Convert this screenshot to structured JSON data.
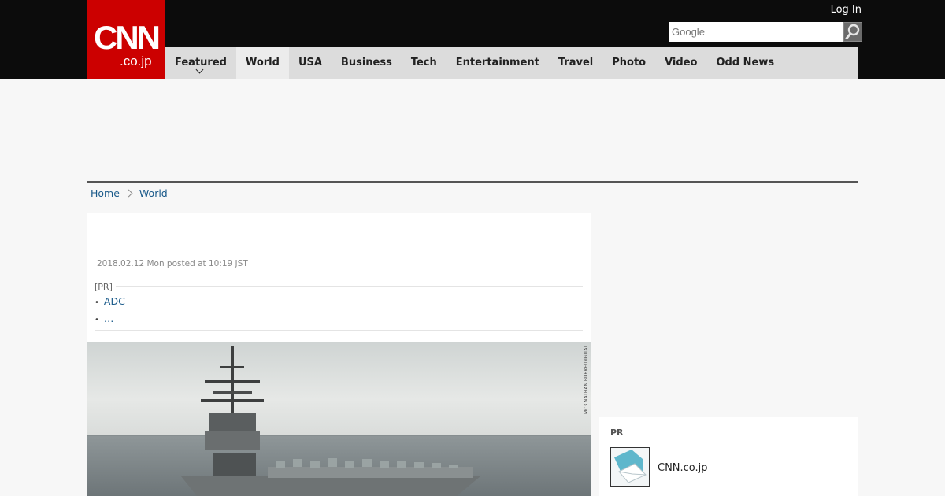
{
  "header": {
    "logo_main": "CNN",
    "logo_sub": ".co.jp",
    "login_label": "Log In",
    "search_placeholder": "Google"
  },
  "nav": {
    "items": [
      {
        "label": "Featured"
      },
      {
        "label": "World"
      },
      {
        "label": "USA"
      },
      {
        "label": "Business"
      },
      {
        "label": "Tech"
      },
      {
        "label": "Entertainment"
      },
      {
        "label": "Travel"
      },
      {
        "label": "Photo"
      },
      {
        "label": "Video"
      },
      {
        "label": "Odd News"
      }
    ],
    "active": "World"
  },
  "breadcrumb": {
    "home": "Home",
    "current": "World"
  },
  "article": {
    "posted": "2018.02.12 Mon posted at 10:19 JST",
    "pr_tag": "[PR]",
    "pr_links": [
      "ADC",
      "…"
    ],
    "photo_credit": "MC3 NATHAN BURKE/DIGITAL"
  },
  "sidebar": {
    "pr_title": "PR",
    "pr_item_label": "CNN.co.jp"
  },
  "colors": {
    "brand_red": "#cc0000",
    "header_bg": "#0c0c0c",
    "nav_bg": "#dcdcdc",
    "link": "#1a5a8a"
  }
}
